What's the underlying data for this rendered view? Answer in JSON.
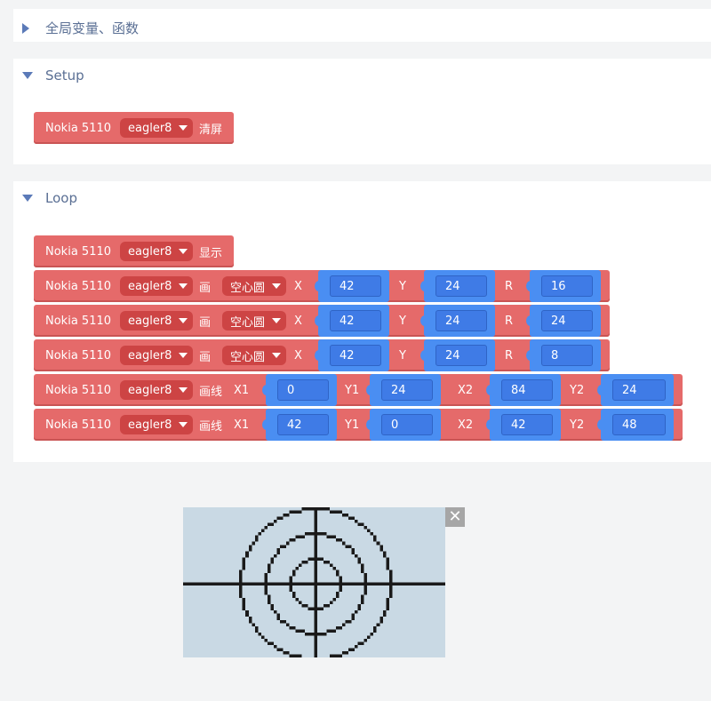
{
  "sections": {
    "globals": {
      "label": "全局变量、函数"
    },
    "setup": {
      "label": "Setup"
    },
    "loop": {
      "label": "Loop"
    }
  },
  "blocks": {
    "setup_clear": {
      "device": "Nokia 5110",
      "instance": "eagler8",
      "action": "清屏"
    },
    "loop_display": {
      "device": "Nokia 5110",
      "instance": "eagler8",
      "action": "显示"
    },
    "loop_circles": [
      {
        "device": "Nokia 5110",
        "instance": "eagler8",
        "action": "画",
        "shape": "空心圆",
        "x_label": "X",
        "x": "42",
        "y_label": "Y",
        "y": "24",
        "r_label": "R",
        "r": "16"
      },
      {
        "device": "Nokia 5110",
        "instance": "eagler8",
        "action": "画",
        "shape": "空心圆",
        "x_label": "X",
        "x": "42",
        "y_label": "Y",
        "y": "24",
        "r_label": "R",
        "r": "24"
      },
      {
        "device": "Nokia 5110",
        "instance": "eagler8",
        "action": "画",
        "shape": "空心圆",
        "x_label": "X",
        "x": "42",
        "y_label": "Y",
        "y": "24",
        "r_label": "R",
        "r": "8"
      }
    ],
    "loop_lines": [
      {
        "device": "Nokia 5110",
        "instance": "eagler8",
        "action": "画线",
        "x1_label": "X1",
        "x1": "0",
        "y1_label": "Y1",
        "y1": "24",
        "x2_label": "X2",
        "x2": "84",
        "y2_label": "Y2",
        "y2": "24"
      },
      {
        "device": "Nokia 5110",
        "instance": "eagler8",
        "action": "画线",
        "x1_label": "X1",
        "x1": "42",
        "y1_label": "Y1",
        "y1": "0",
        "x2_label": "X2",
        "x2": "42",
        "y2_label": "Y2",
        "y2": "48"
      }
    ]
  },
  "preview": {
    "close_label": "✕",
    "background_color": "#c9d9e4",
    "pixel_color": "#1a1a1a",
    "screen_cols": 84,
    "screen_rows": 48
  },
  "colors": {
    "block_red": "#e56a6a",
    "dropdown_red": "#cd4444",
    "value_blue": "#4a8ef2",
    "section_arrow": "#5b7ab8"
  }
}
